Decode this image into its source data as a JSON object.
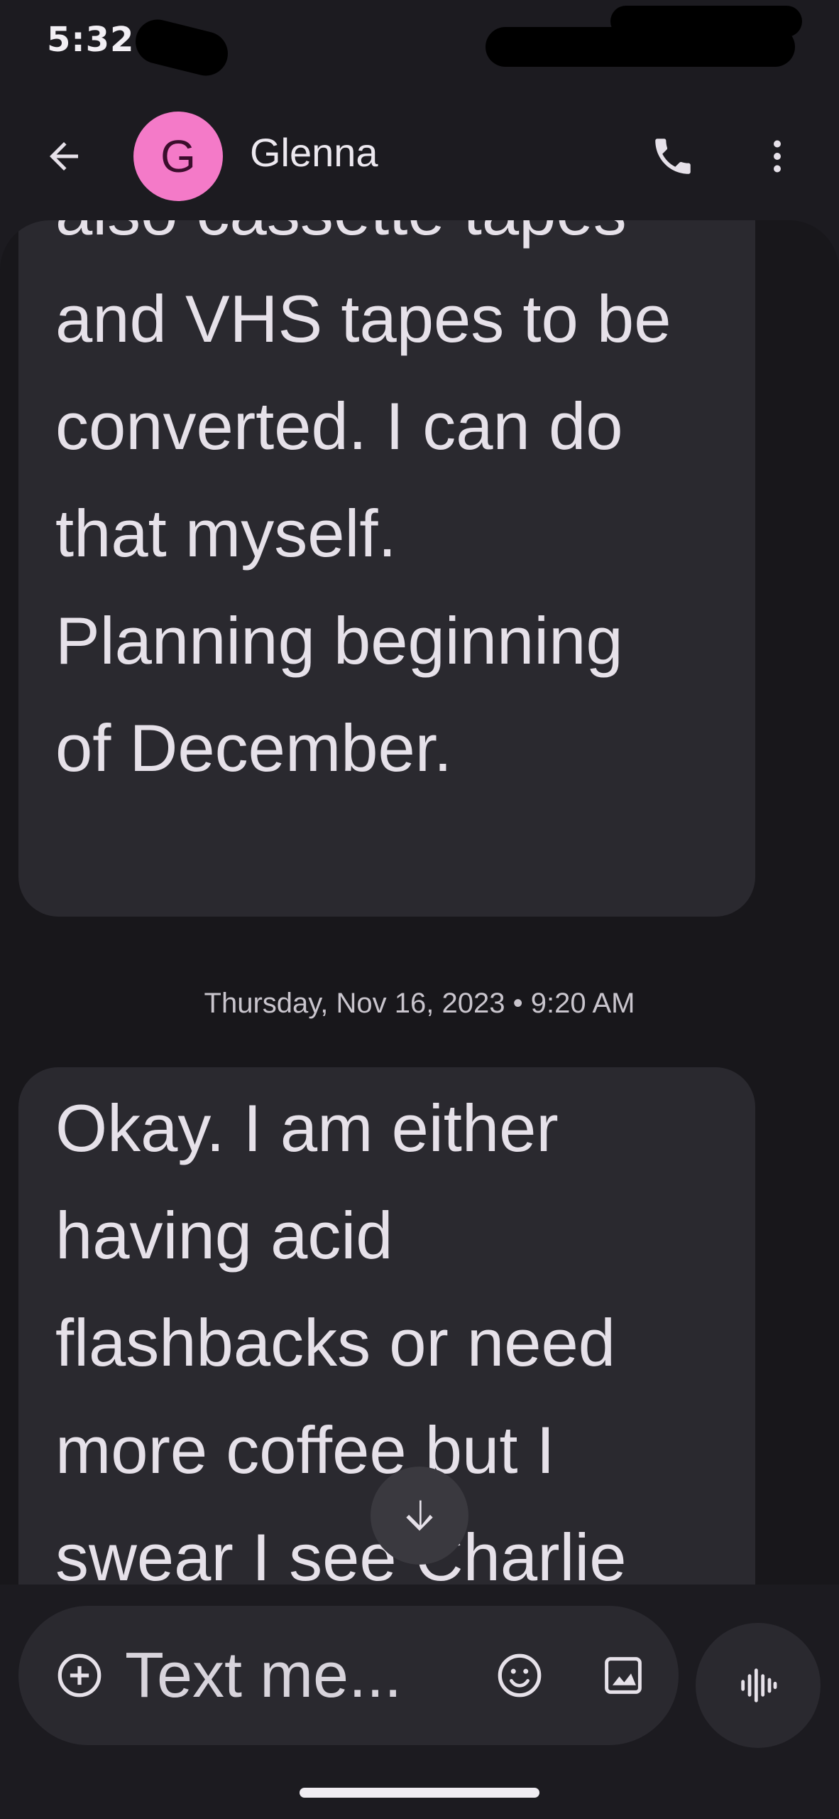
{
  "status_bar": {
    "time": "5:32"
  },
  "header": {
    "avatar_letter": "G",
    "contact_name": "Glenna",
    "avatar_color": "#f47ac8"
  },
  "messages": [
    {
      "text": "also cassette tapes\nand VHS tapes to be\nconverted. I can do\nthat myself.\nPlanning beginning\nof December."
    },
    {
      "timestamp": "Thursday, Nov 16, 2023 • 9:20 AM"
    },
    {
      "text": "Okay. I am either\nhaving acid\nflashbacks or need\nmore coffee but I\nswear I see Charlie"
    }
  ],
  "composer": {
    "placeholder": "Text me..."
  },
  "colors": {
    "background": "#1c1b20",
    "bubble": "#2a292f",
    "text": "#e6e1e9"
  },
  "icons": {
    "back": "arrow-back-icon",
    "call": "phone-icon",
    "more": "more-vert-icon",
    "scroll": "arrow-down-icon",
    "add": "add-circle-icon",
    "emoji": "emoji-icon",
    "media": "image-icon",
    "voice": "voice-waveform-icon"
  }
}
